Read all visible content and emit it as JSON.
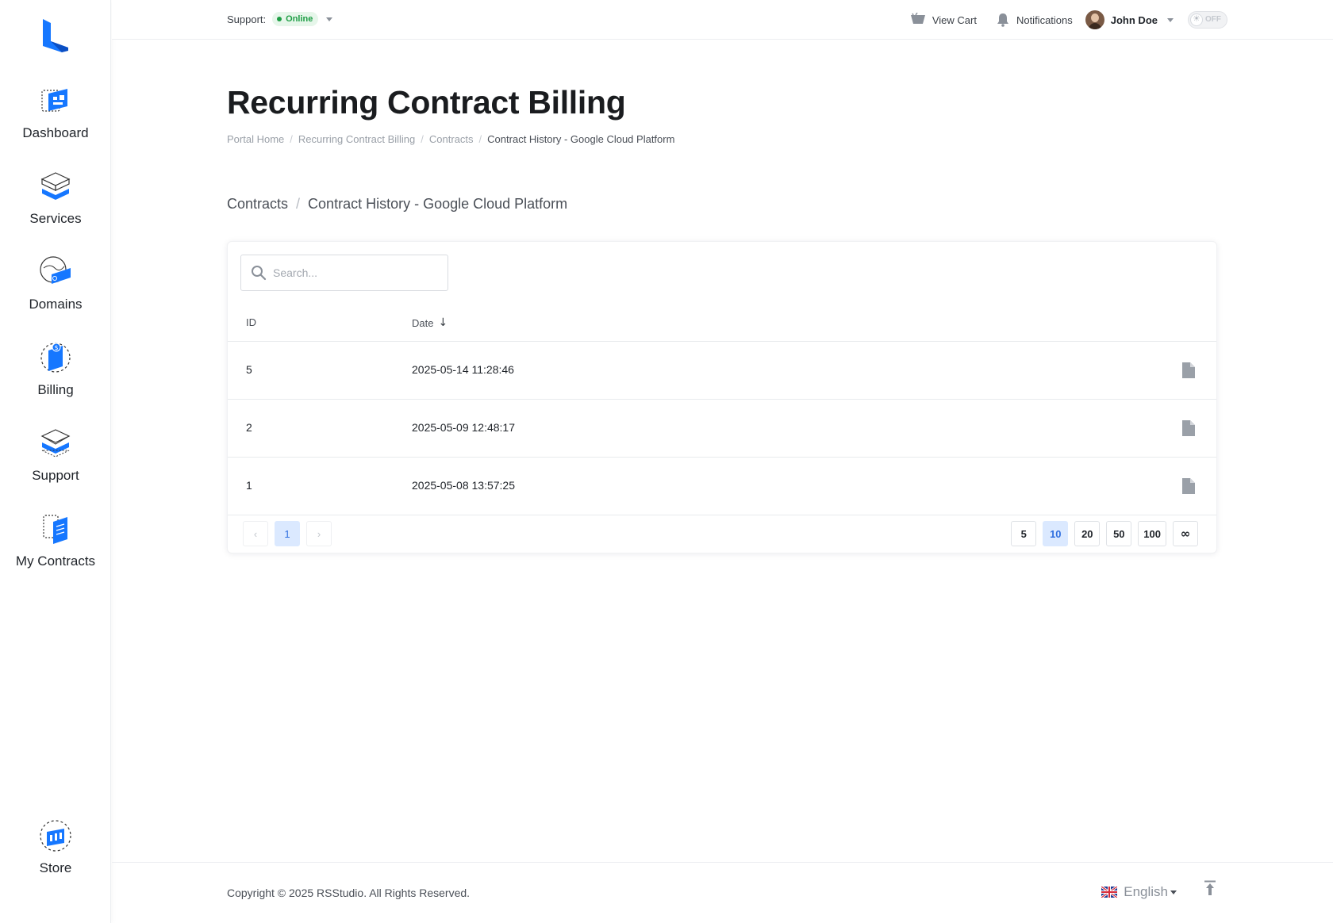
{
  "sidebar": {
    "logo": "brand-logo",
    "items": [
      {
        "label": "Dashboard",
        "icon": "dashboard-icon"
      },
      {
        "label": "Services",
        "icon": "services-icon"
      },
      {
        "label": "Domains",
        "icon": "domains-icon"
      },
      {
        "label": "Billing",
        "icon": "billing-icon"
      },
      {
        "label": "Support",
        "icon": "support-icon"
      },
      {
        "label": "My Contracts",
        "icon": "contracts-icon"
      }
    ],
    "bottom_item": {
      "label": "Store",
      "icon": "store-icon"
    }
  },
  "topbar": {
    "support_label": "Support:",
    "support_status": "Online",
    "view_cart": "View Cart",
    "notifications": "Notifications",
    "user_name": "John Doe",
    "theme_toggle": "OFF"
  },
  "page": {
    "title": "Recurring Contract Billing",
    "breadcrumb": [
      "Portal Home",
      "Recurring Contract Billing",
      "Contracts",
      "Contract History - Google Cloud Platform"
    ],
    "section_link": "Contracts",
    "section_current": "Contract History - Google Cloud Platform"
  },
  "table": {
    "search_placeholder": "Search...",
    "columns": {
      "id": "ID",
      "date": "Date"
    },
    "rows": [
      {
        "id": "5",
        "date": "2025-05-14 11:28:46"
      },
      {
        "id": "2",
        "date": "2025-05-09 12:48:17"
      },
      {
        "id": "1",
        "date": "2025-05-08 13:57:25"
      }
    ],
    "pagination": {
      "prev": "‹",
      "current": "1",
      "next": "›"
    },
    "page_sizes": [
      "5",
      "10",
      "20",
      "50",
      "100",
      "∞"
    ],
    "selected_page_size": "10"
  },
  "footer": {
    "copyright": "Copyright © 2025 RSStudio. All Rights Reserved.",
    "language": "English"
  },
  "colors": {
    "accent": "#1677ff",
    "online": "#1e9e45",
    "active_bg": "#dbe9ff"
  }
}
